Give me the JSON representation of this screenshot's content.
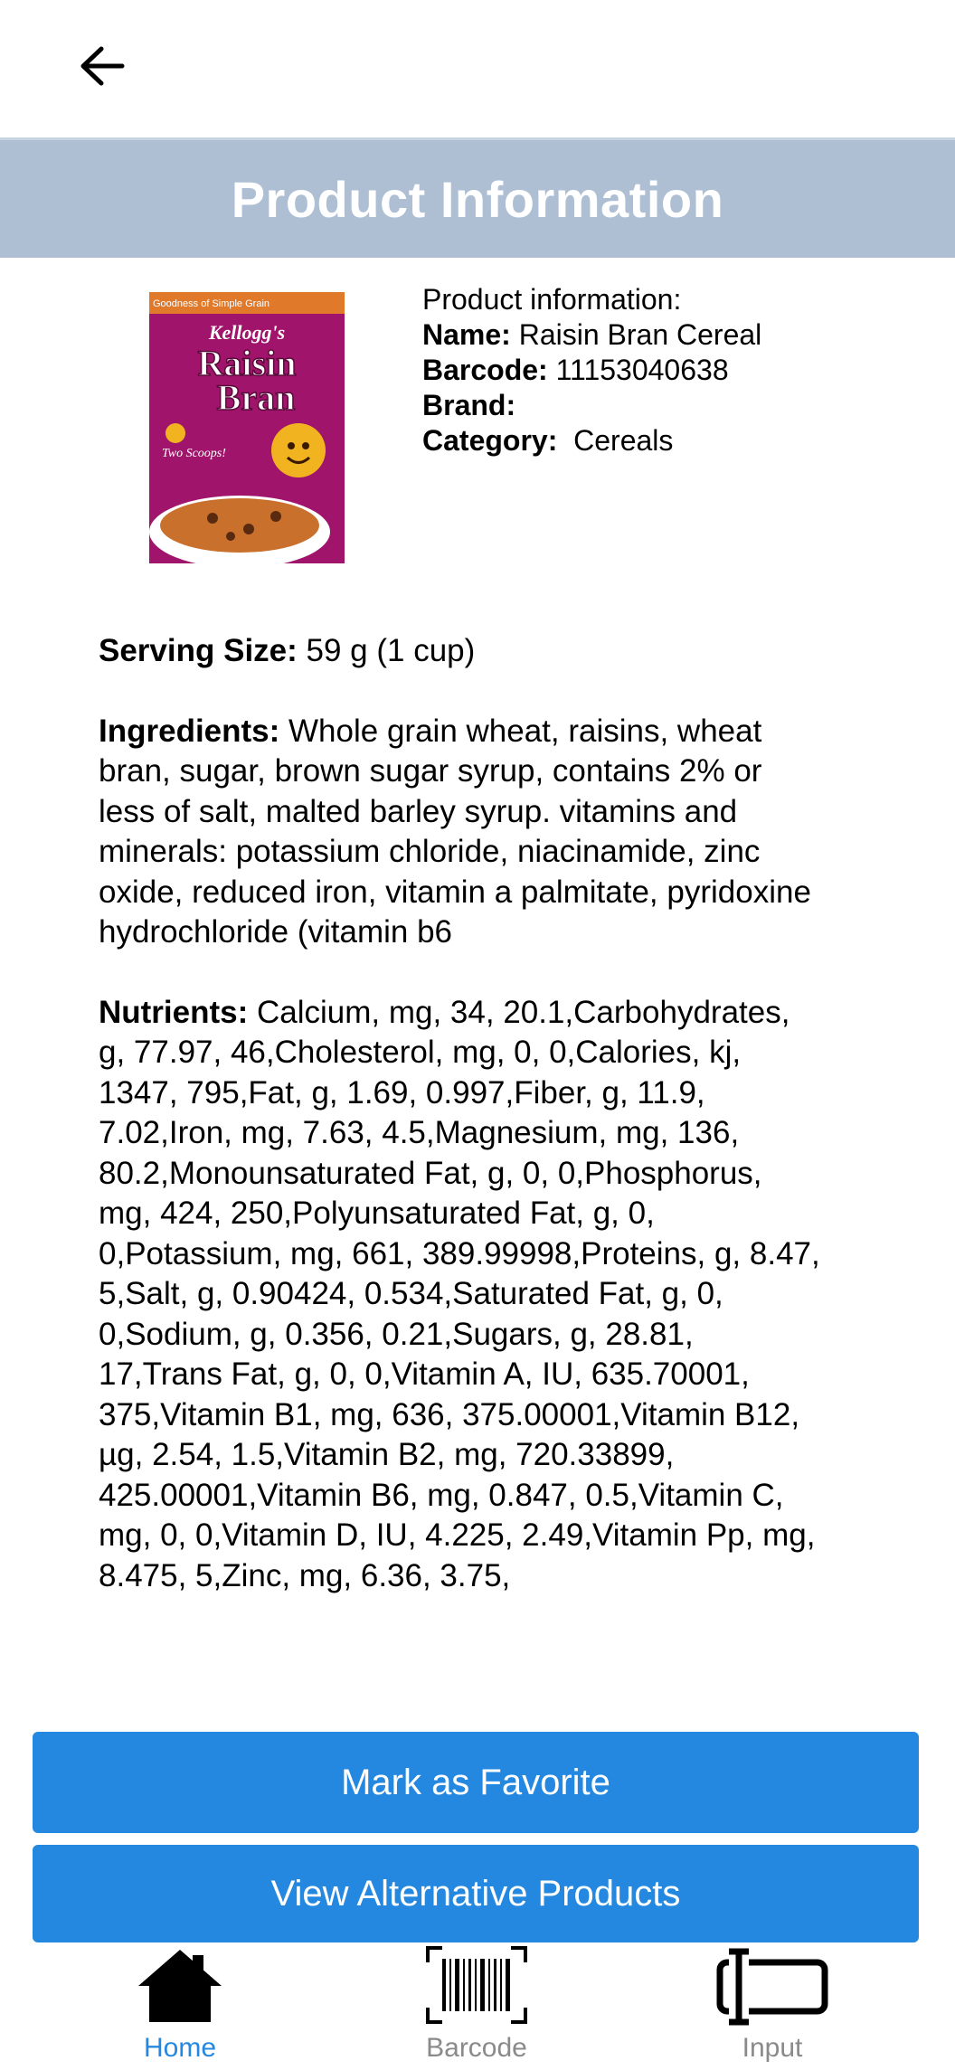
{
  "header": {
    "back_icon": "arrow-left-icon"
  },
  "banner": {
    "title": "Product Information"
  },
  "product": {
    "image_alt": "Kellogg's Raisin Bran cereal box",
    "box_text": {
      "brand": "Kellogg's",
      "name_line1": "Raisin",
      "name_line2": "Bran",
      "tagline": "Two Scoops!",
      "top_strip": "Goodness of Simple Grain"
    },
    "info_heading": "Product information:",
    "name_label": "Name:",
    "name_value": " Raisin Bran Cereal",
    "barcode_label": "Barcode:",
    "barcode_value": " 11153040638",
    "brand_label": "Brand:",
    "brand_value": "",
    "category_label": "Category:",
    "category_value": "  Cereals"
  },
  "details": {
    "serving_label": "Serving Size:",
    "serving_value": " 59 g (1 cup)",
    "ingredients_label": "Ingredients:",
    "ingredients_value": " Whole grain wheat, raisins, wheat bran, sugar, brown sugar syrup, contains 2% or less of salt, malted barley syrup. vitamins and minerals: potassium chloride, niacinamide, zinc oxide, reduced iron, vitamin a palmitate, pyridoxine hydrochloride (vitamin b6",
    "nutrients_label": "Nutrients:",
    "nutrients_value": " Calcium, mg, 34, 20.1,Carbohydrates, g, 77.97, 46,Cholesterol, mg, 0, 0,Calories, kj, 1347, 795,Fat, g, 1.69, 0.997,Fiber, g, 11.9, 7.02,Iron, mg, 7.63, 4.5,Magnesium, mg, 136, 80.2,Monounsaturated Fat, g, 0, 0,Phosphorus, mg, 424, 250,Polyunsaturated Fat, g, 0, 0,Potassium, mg, 661, 389.99998,Proteins, g, 8.47, 5,Salt, g, 0.90424, 0.534,Saturated Fat, g, 0, 0,Sodium, g, 0.356, 0.21,Sugars, g, 28.81, 17,Trans Fat, g, 0, 0,Vitamin A, IU, 635.70001, 375,Vitamin B1, mg, 636, 375.00001,Vitamin B12, µg, 2.54, 1.5,Vitamin B2, mg, 720.33899, 425.00001,Vitamin B6, mg, 0.847, 0.5,Vitamin C, mg, 0, 0,Vitamin D, IU, 4.225, 2.49,Vitamin Pp, mg, 8.475, 5,Zinc, mg, 6.36, 3.75,"
  },
  "actions": {
    "favorite_label": "Mark as Favorite",
    "alternatives_label": "View Alternative Products"
  },
  "nav": {
    "home_label": "Home",
    "barcode_label": "Barcode",
    "input_label": "Input",
    "active_color": "#2588e0",
    "inactive_color": "#8a8a8a"
  },
  "colors": {
    "banner_bg": "#aebfd4",
    "button_bg": "#2588e0"
  }
}
